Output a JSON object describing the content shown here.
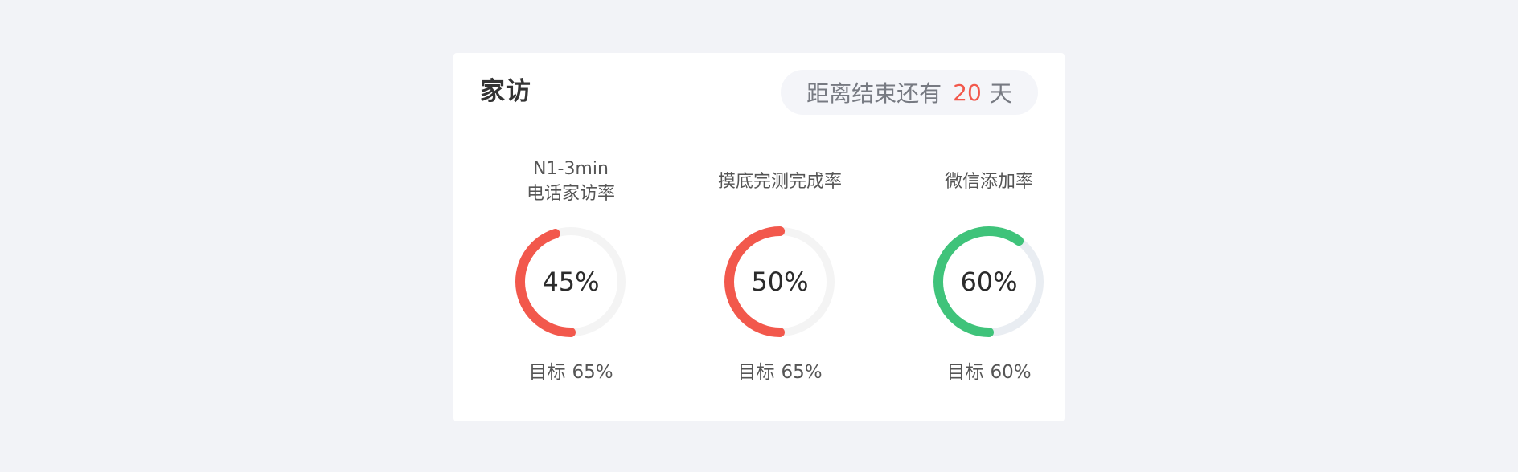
{
  "card": {
    "title": "家访",
    "countdown": {
      "prefix": "距离结束还有",
      "days": "20",
      "suffix": "天"
    }
  },
  "metrics": [
    {
      "title_line1": "N1-3min",
      "title_line2": "电话家访率",
      "value_text": "45%",
      "progress": 0.45,
      "color": "#f2584c",
      "track_color": "#f4f4f4",
      "target_label": "目标",
      "target_value": "65%"
    },
    {
      "title_line1": "摸底完测完成率",
      "title_line2": "",
      "value_text": "50%",
      "progress": 0.5,
      "color": "#f2584c",
      "track_color": "#f4f4f4",
      "target_label": "目标",
      "target_value": "65%"
    },
    {
      "title_line1": "微信添加率",
      "title_line2": "",
      "value_text": "60%",
      "progress": 0.6,
      "color": "#3fc37a",
      "track_color": "#e9edf2",
      "target_label": "目标",
      "target_value": "60%"
    }
  ]
}
